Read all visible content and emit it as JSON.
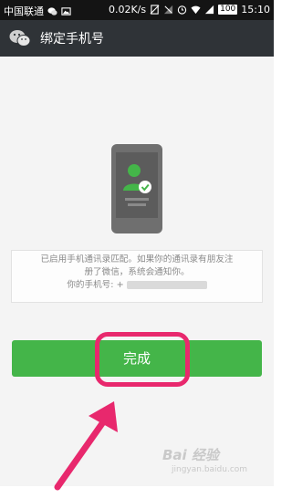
{
  "status_bar": {
    "carrier": "中国联通",
    "speed": "0.02K/s",
    "battery": "100",
    "time": "15:10",
    "icons": [
      "wechat-icon",
      "image-icon",
      "no-sim-icon",
      "signal-off-icon",
      "alarm-icon",
      "wifi-icon",
      "signal-icon"
    ]
  },
  "titlebar": {
    "app_icon": "wechat-logo-icon",
    "title": "绑定手机号"
  },
  "illustration": {
    "icon": "phone-contact-verified-icon"
  },
  "message": {
    "line1": "已启用手机通讯录匹配。如果你的通讯录有朋友注",
    "line2": "册了微信，系统会通知你。",
    "phone_label": "你的手机号: +"
  },
  "done_button": {
    "label": "完成"
  },
  "overlay": {
    "highlight_color": "#e8286d",
    "arrow_color": "#e8286d"
  },
  "watermark": {
    "text": "Bai 经验",
    "sub": "jingyan.baidu.com"
  },
  "colors": {
    "accent_green": "#44b549",
    "titlebar": "#2f3337",
    "status_bar": "#141414"
  }
}
